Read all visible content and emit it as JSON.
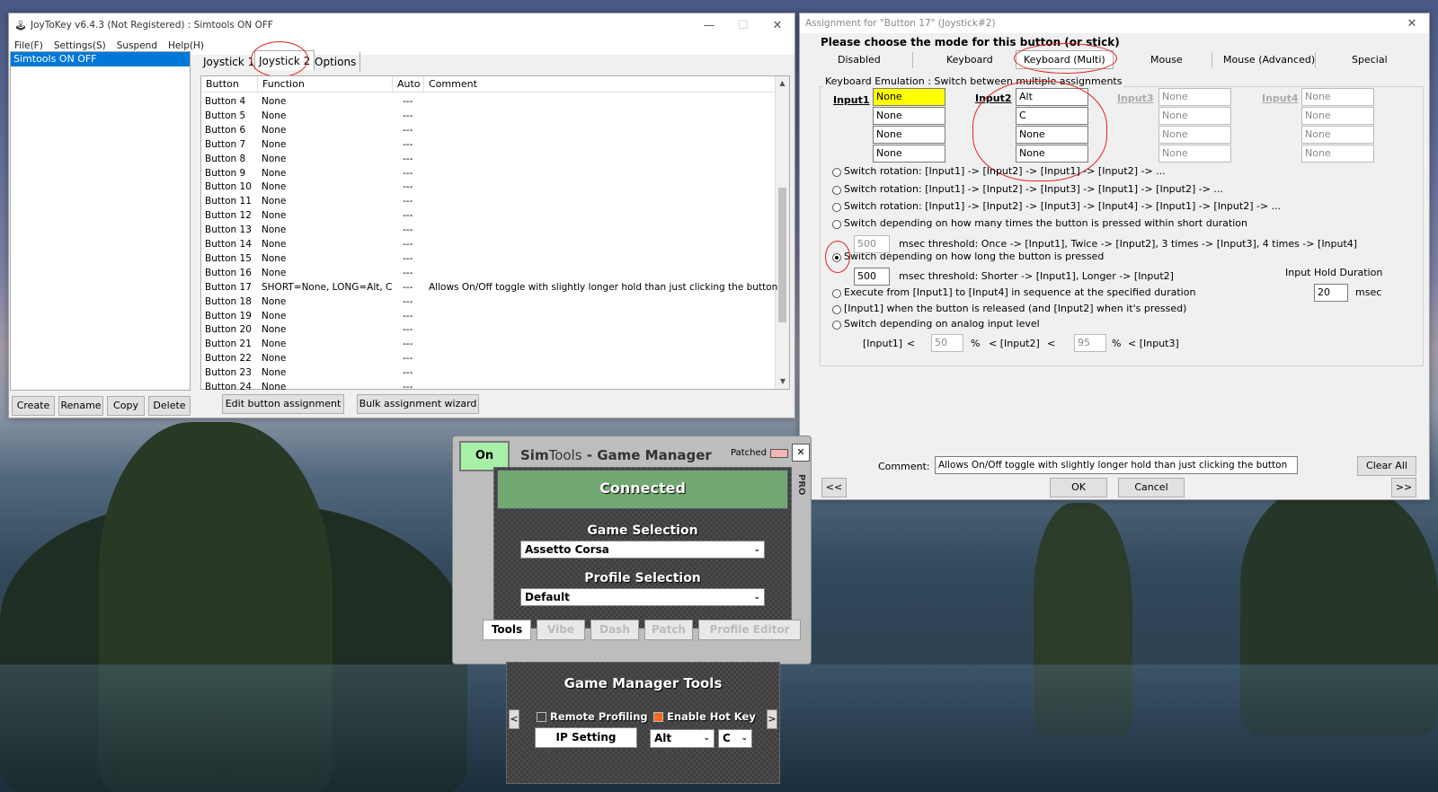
{
  "joytokey": {
    "title": "JoyToKey v6.4.3 (Not Registered) : Simtools ON OFF",
    "menu": [
      "File(F)",
      "Settings(S)",
      "Suspend",
      "Help(H)"
    ],
    "profiles": [
      "Simtools ON OFF"
    ],
    "profile_buttons": [
      "Create",
      "Rename",
      "Copy",
      "Delete"
    ],
    "tabs": [
      "Joystick 1",
      "Joystick 2",
      "Options"
    ],
    "columns": [
      "Button",
      "Function",
      "Auto",
      "Comment"
    ],
    "rows": [
      {
        "button": "Button 4",
        "function": "None",
        "auto": "---",
        "comment": ""
      },
      {
        "button": "Button 5",
        "function": "None",
        "auto": "---",
        "comment": ""
      },
      {
        "button": "Button 6",
        "function": "None",
        "auto": "---",
        "comment": ""
      },
      {
        "button": "Button 7",
        "function": "None",
        "auto": "---",
        "comment": ""
      },
      {
        "button": "Button 8",
        "function": "None",
        "auto": "---",
        "comment": ""
      },
      {
        "button": "Button 9",
        "function": "None",
        "auto": "---",
        "comment": ""
      },
      {
        "button": "Button 10",
        "function": "None",
        "auto": "---",
        "comment": ""
      },
      {
        "button": "Button 11",
        "function": "None",
        "auto": "---",
        "comment": ""
      },
      {
        "button": "Button 12",
        "function": "None",
        "auto": "---",
        "comment": ""
      },
      {
        "button": "Button 13",
        "function": "None",
        "auto": "---",
        "comment": ""
      },
      {
        "button": "Button 14",
        "function": "None",
        "auto": "---",
        "comment": ""
      },
      {
        "button": "Button 15",
        "function": "None",
        "auto": "---",
        "comment": ""
      },
      {
        "button": "Button 16",
        "function": "None",
        "auto": "---",
        "comment": ""
      },
      {
        "button": "Button 17",
        "function": "SHORT=None, LONG=Alt, C",
        "auto": "---",
        "comment": "Allows On/Off toggle with slightly longer hold than just clicking the button"
      },
      {
        "button": "Button 18",
        "function": "None",
        "auto": "---",
        "comment": ""
      },
      {
        "button": "Button 19",
        "function": "None",
        "auto": "---",
        "comment": ""
      },
      {
        "button": "Button 20",
        "function": "None",
        "auto": "---",
        "comment": ""
      },
      {
        "button": "Button 21",
        "function": "None",
        "auto": "---",
        "comment": ""
      },
      {
        "button": "Button 22",
        "function": "None",
        "auto": "---",
        "comment": ""
      },
      {
        "button": "Button 23",
        "function": "None",
        "auto": "---",
        "comment": ""
      },
      {
        "button": "Button 24",
        "function": "None",
        "auto": "---",
        "comment": ""
      }
    ],
    "bottom_buttons": [
      "Edit button assignment",
      "Bulk assignment wizard"
    ]
  },
  "assign": {
    "title": "Assignment for \"Button 17\" (Joystick#2)",
    "heading": "Please choose the mode for this button (or stick)",
    "modes": [
      "Disabled",
      "Keyboard",
      "Keyboard (Multi)",
      "Mouse",
      "Mouse (Advanced)",
      "Special"
    ],
    "group_label": "Keyboard Emulation : Switch between multiple assignments",
    "input_labels": [
      "Input1",
      "Input2",
      "Input3",
      "Input4"
    ],
    "inputs": [
      [
        "None",
        "None",
        "None",
        "None"
      ],
      [
        "Alt",
        "C",
        "None",
        "None"
      ],
      [
        "None",
        "None",
        "None",
        "None"
      ],
      [
        "None",
        "None",
        "None",
        "None"
      ]
    ],
    "options": [
      "Switch rotation: [Input1] -> [Input2] -> [Input1] -> [Input2] -> ...",
      "Switch rotation: [Input1] -> [Input2] -> [Input3] -> [Input1] -> [Input2] -> ...",
      "Switch rotation: [Input1] -> [Input2] -> [Input3] -> [Input4] -> [Input1] -> [Input2] -> ...",
      "Switch depending on how many times the button is pressed within short duration",
      "Switch depending on how long the button is pressed",
      "Execute from [Input1] to [Input4] in sequence at the specified duration",
      "[Input1] when the button is released (and [Input2] when it's pressed)",
      "Switch depending on analog input level"
    ],
    "count_threshold": "500",
    "count_threshold_text": "msec threshold: Once -> [Input1], Twice -> [Input2], 3 times -> [Input3], 4 times -> [Input4]",
    "hold_threshold": "500",
    "hold_threshold_text": "msec threshold: Shorter -> [Input1], Longer -> [Input2]",
    "hold_duration_label": "Input Hold Duration",
    "hold_duration_value": "20",
    "hold_duration_unit": "msec",
    "analog": {
      "in1": "[Input1]",
      "lt": "<",
      "v1": "50",
      "pct": "%",
      "in2": "< [Input2]",
      "v2": "95",
      "in3": "< [Input3]"
    },
    "comment_label": "Comment:",
    "comment_value": "Allows On/Off toggle with slightly longer hold than just clicking the button",
    "clear_all": "Clear All",
    "prev": "<<",
    "next": ">>",
    "ok": "OK",
    "cancel": "Cancel"
  },
  "simtools": {
    "on_button": "On",
    "title_sim": "Sim",
    "title_tools": "Tools",
    "title_rest": " - Game Manager",
    "patched": "Patched",
    "close": "✕",
    "pro": "PRO",
    "status": "Connected",
    "game_selection_label": "Game Selection",
    "game_selection_value": "Assetto Corsa",
    "profile_selection_label": "Profile Selection",
    "profile_selection_value": "Default",
    "tabs": [
      "Tools",
      "Vibe",
      "Dash",
      "Patch",
      "Profile Editor"
    ],
    "tools_title": "Game Manager Tools",
    "remote_profiling": "Remote Profiling",
    "enable_hot_key": "Enable Hot Key",
    "ip_setting": "IP Setting",
    "hotkey_mod": "Alt",
    "hotkey_key": "C",
    "arrow_left": "<",
    "arrow_right": ">"
  }
}
